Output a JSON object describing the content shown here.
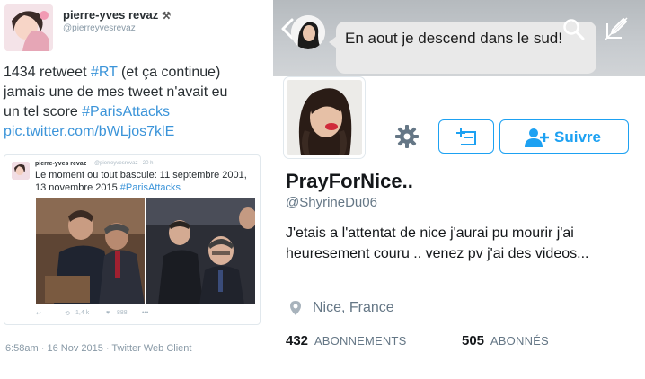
{
  "tweet": {
    "author_name": "pierre-yves revaz",
    "author_deco": "⚒",
    "author_handle": "@pierreyvesrevaz",
    "text_line1": "1434 retweet ",
    "hashtag_rt": "#RT",
    "text_line1b": "  (et ça continue)",
    "text_line2": "jamais une de mes tweet n'avait eu",
    "text_line3": "un tel score ",
    "hashtag_paris": "#ParisAttacks",
    "pic_link": "pic.twitter.com/bWLjos7klE",
    "embedded": {
      "author_name": "pierre-yves revaz",
      "author_handle": "@pierreyvesrevaz · 20 h",
      "text": "Le moment ou tout bascule: 11 septembre 2001, 13 novembre 2015 ",
      "hashtag": "#ParisAttacks",
      "retweet_count": "1,4 k",
      "like_count": "888"
    },
    "meta": "6:58am · 16 Nov 2015 · Twitter Web Client"
  },
  "profile": {
    "dm_message": "En aout je descend dans le sud!",
    "display_name": "PrayForNice..",
    "screen_name": "@ShyrineDu06",
    "bio": "J'etais a l'attentat de nice j'aurai pu mourir j'ai heuresement couru .. venez pv j'ai des videos...",
    "location": "Nice, France",
    "follow_label": "Suivre",
    "following_count": "432",
    "following_label": "ABONNEMENTS",
    "followers_count": "505",
    "followers_label": "ABONNÉS",
    "accent_color": "#1da1f2",
    "icons": [
      "back-icon",
      "search-icon",
      "compose-icon",
      "gear-icon",
      "add-to-list-icon",
      "add-user-icon",
      "location-pin-icon"
    ]
  }
}
